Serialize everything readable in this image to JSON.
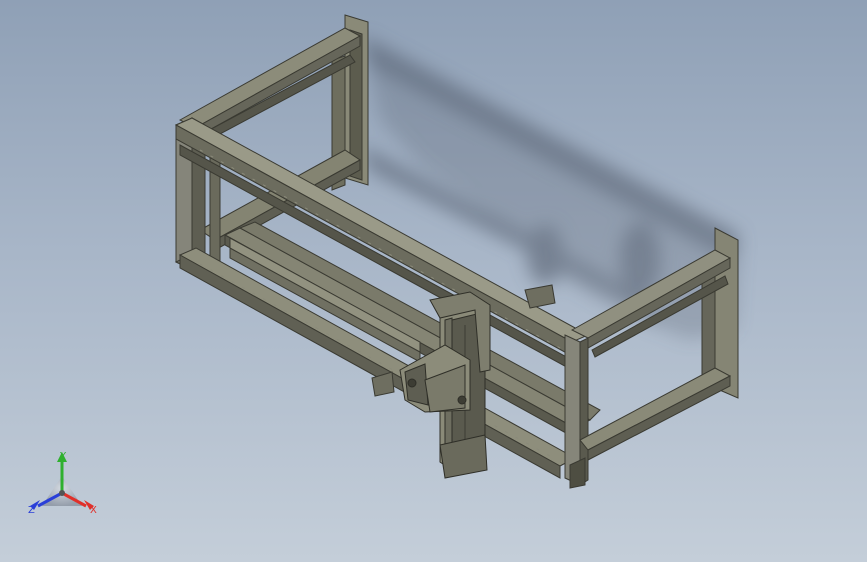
{
  "viewport": {
    "background_top": "#8fa0b6",
    "background_bottom": "#c4ced9",
    "model": {
      "frame_color": "#7a7a6a",
      "frame_dark": "#4e4e42",
      "frame_light": "#9a9a88",
      "shadow_color": "#5f6a7a"
    }
  },
  "triad": {
    "x_label": "X",
    "y_label": "Y",
    "z_label": "Z",
    "x_color": "#e0302a",
    "y_color": "#2fb02f",
    "z_color": "#2a3fd8"
  }
}
